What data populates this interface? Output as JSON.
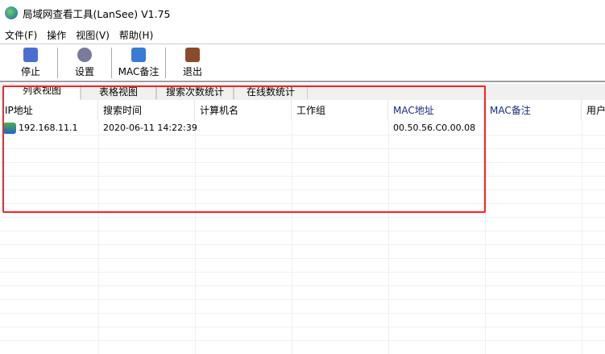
{
  "window": {
    "title": "局域网查看工具(LanSee) V1.75"
  },
  "menu": [
    "文件(F)",
    "操作",
    "视图(V)",
    "帮助(H)"
  ],
  "toolbar": [
    {
      "label": "停止",
      "icon": "stop-icon",
      "color": "#4a6fd0"
    },
    {
      "label": "设置",
      "icon": "gear-icon",
      "color": "#7a7a9a"
    },
    {
      "label": "MAC备注",
      "icon": "note-icon",
      "color": "#3a7bd5"
    },
    {
      "label": "退出",
      "icon": "exit-boot-icon",
      "color": "#8b4a2a"
    }
  ],
  "tabs": [
    "列表视图",
    "表格视图",
    "搜索次数统计",
    "在线数统计"
  ],
  "columns": [
    "IP地址",
    "搜索时间",
    "计算机名",
    "工作组",
    "MAC地址",
    "MAC备注",
    "用户"
  ],
  "rows": [
    {
      "ip": "192.168.11.1",
      "time": "2020-06-11 14:22:39",
      "name": "",
      "group": "",
      "mac": "00.50.56.C0.00.08",
      "note": "",
      "user": ""
    }
  ],
  "highlight_color": "#ff2020"
}
